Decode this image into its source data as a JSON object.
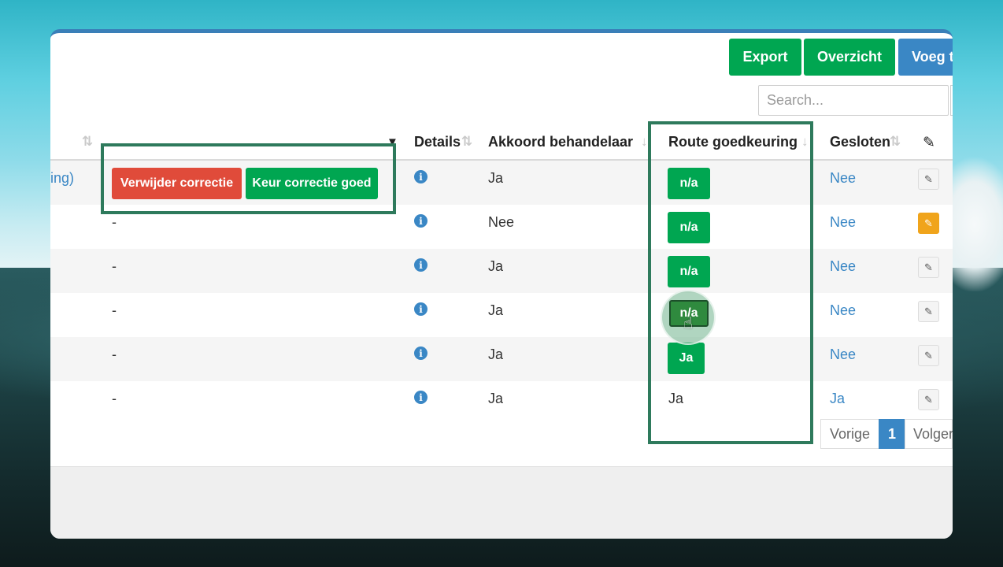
{
  "toolbar": {
    "export_label": "Export",
    "overview_label": "Overzicht",
    "add_label": "Voeg t",
    "search_placeholder": "Search..."
  },
  "columns": {
    "details": "Details",
    "agreement": "Akkoord behandelaar",
    "route": "Route goedkeuring",
    "closed": "Gesloten"
  },
  "actions": {
    "delete_label": "Verwijder correctie",
    "approve_label": "Keur correctie goed"
  },
  "rows": [
    {
      "first": "ing)",
      "dash": "",
      "akkoord": "Ja",
      "route": "n/a",
      "gesloten": "Nee"
    },
    {
      "first": "",
      "dash": "-",
      "akkoord": "Nee",
      "route": "n/a",
      "gesloten": "Nee"
    },
    {
      "first": "",
      "dash": "-",
      "akkoord": "Ja",
      "route": "n/a",
      "gesloten": "Nee"
    },
    {
      "first": "",
      "dash": "-",
      "akkoord": "Ja",
      "route": "n/a",
      "gesloten": "Nee"
    },
    {
      "first": "",
      "dash": "-",
      "akkoord": "Ja",
      "route": "Ja",
      "gesloten": "Nee"
    },
    {
      "first": "",
      "dash": "-",
      "akkoord": "Ja",
      "route": "Ja",
      "gesloten": "Ja"
    }
  ],
  "pagination": {
    "prev_label": "Vorige",
    "current_page": "1",
    "next_label": "Volger"
  },
  "colors": {
    "green": "#00a651",
    "blue": "#3a87c5",
    "red": "#e04b3a",
    "orange": "#f0a41b",
    "highlight": "#2e7a5c"
  }
}
